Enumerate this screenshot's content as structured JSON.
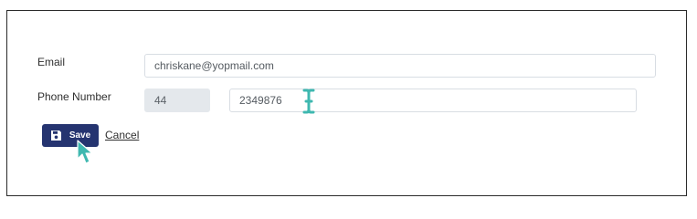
{
  "form": {
    "email_label": "Email",
    "email_value": "chriskane@yopmail.com",
    "phone_label": "Phone Number",
    "country_code_value": "44",
    "phone_value": "2349876"
  },
  "actions": {
    "save_label": "Save",
    "cancel_label": "Cancel"
  },
  "icons": {
    "save": "floppy-disk-icon",
    "text_cursor": "text-cursor-icon",
    "mouse_pointer": "mouse-pointer-icon"
  },
  "colors": {
    "primary_button": "#253470",
    "cursor_accent": "#3fb8b0",
    "readonly_field": "#e4e8ec"
  }
}
